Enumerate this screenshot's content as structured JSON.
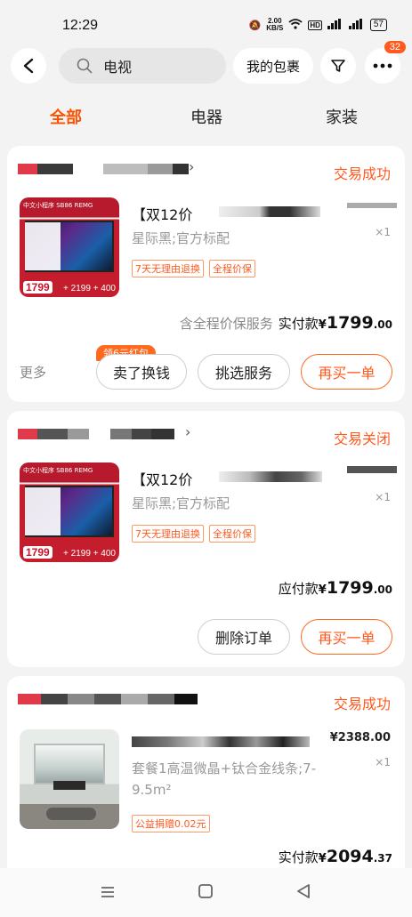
{
  "status_bar": {
    "time": "12:29",
    "net_speed_value": "2.00",
    "net_speed_unit": "KB/S",
    "hd": "HD",
    "battery": "57"
  },
  "header": {
    "search_query": "电视",
    "my_package_label": "我的包裹",
    "badge_count": "32"
  },
  "tabs": [
    {
      "label": "全部",
      "active": true
    },
    {
      "label": "电器",
      "active": false
    },
    {
      "label": "家装",
      "active": false
    }
  ],
  "orders": [
    {
      "status": "交易成功",
      "title": "【双12价",
      "spec": "星际黑;官方标配",
      "qty": "×1",
      "tags": [
        "7天无理由退换",
        "全程价保"
      ],
      "thumb": {
        "head": "中文小程序 SB86 REMG",
        "price": "1799",
        "price2": "+ 2199 + 400"
      },
      "pay_prefix": "含全程价保服务",
      "pay_label": "实付款",
      "pay_currency": "¥",
      "pay_amount": "1799",
      "pay_decimal": ".00",
      "more": "更多",
      "coupon": "领6元红包",
      "buttons": [
        "卖了换钱",
        "挑选服务",
        "再买一单"
      ]
    },
    {
      "status": "交易关闭",
      "title": "【双12价",
      "spec": "星际黑;官方标配",
      "qty": "×1",
      "tags": [
        "7天无理由退换",
        "全程价保"
      ],
      "thumb": {
        "head": "中文小程序 SB86 REMG",
        "price": "1799",
        "price2": "+ 2199 + 400"
      },
      "pay_label": "应付款",
      "pay_currency": "¥",
      "pay_amount": "1799",
      "pay_decimal": ".00",
      "buttons": [
        "删除订单",
        "再买一单"
      ]
    },
    {
      "status": "交易成功",
      "spec": "套餐1高温微晶+钛合金线条;7-9.5m²",
      "unit_price": "¥2388.00",
      "qty": "×1",
      "tags": [
        "公益捐赠0.02元"
      ],
      "pay_label": "实付款",
      "pay_currency": "¥",
      "pay_amount": "2094",
      "pay_decimal": ".37"
    }
  ],
  "colors": {
    "accent": "#ff5a1f",
    "background": "#f3f3f3"
  }
}
